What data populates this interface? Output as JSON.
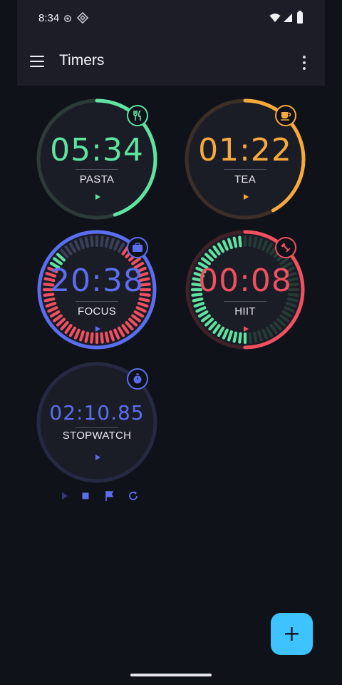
{
  "status_bar": {
    "time": "8:34"
  },
  "app_bar": {
    "title": "Timers"
  },
  "timers": [
    {
      "id": "pasta",
      "time": "05:34",
      "label": "PASTA",
      "icon": "utensils-icon",
      "color": "#5ee3a1",
      "progress": 0.45
    },
    {
      "id": "tea",
      "time": "01:22",
      "label": "TEA",
      "icon": "coffee-cup-icon",
      "color": "#f7a93b",
      "progress": 0.42
    },
    {
      "id": "focus",
      "time": "20:38",
      "label": "FOCUS",
      "icon": "briefcase-icon",
      "color": "#5b6ef0"
    },
    {
      "id": "hiit",
      "time": "00:08",
      "label": "HIIT",
      "icon": "dumbbell-icon",
      "color": "#f05060"
    },
    {
      "id": "stopwatch",
      "time": "02:10.85",
      "label": "STOPWATCH",
      "icon": "stopwatch-icon",
      "color": "#5b6ef0"
    }
  ],
  "colors": {
    "background": "#10121a",
    "bar": "#1c1d27",
    "fab": "#3ec3ff",
    "green": "#5ee3a1",
    "red": "#f05060",
    "blue": "#5b6ef0",
    "orange": "#f7a93b"
  },
  "stopwatch_controls": [
    "play-icon",
    "stop-icon",
    "flag-icon",
    "reset-icon"
  ],
  "fab": {
    "label": "+"
  }
}
